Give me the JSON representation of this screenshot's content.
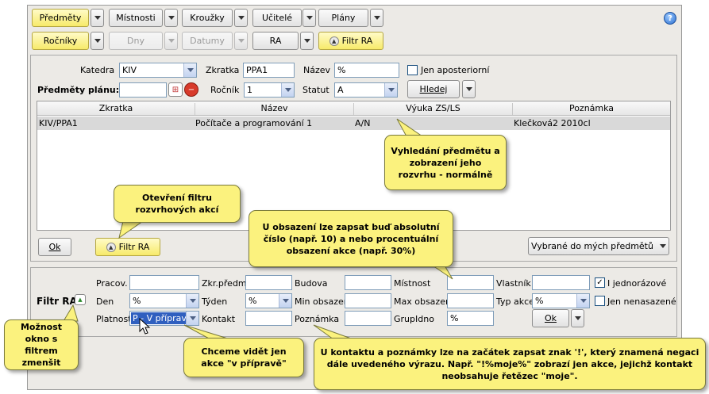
{
  "toolbar": {
    "row1": [
      "Předměty",
      "Místnosti",
      "Kroužky",
      "Učitelé",
      "Plány"
    ],
    "row2": [
      "Ročníky",
      "Dny",
      "Datumy",
      "RA",
      "Filtr RA"
    ]
  },
  "search": {
    "katedra_label": "Katedra",
    "katedra_value": "KIV",
    "zkratka_label": "Zkratka",
    "zkratka_value": "PPA1",
    "nazev_label": "Název",
    "nazev_value": "%",
    "jen_aposteriorni_label": "Jen aposteriorní",
    "predmety_planu_label": "Předměty plánu:",
    "rocnik_label": "Ročník",
    "rocnik_value": "1",
    "statut_label": "Statut",
    "statut_value": "A",
    "hledej_label": "Hledej"
  },
  "grid": {
    "columns": [
      "Zkratka",
      "Název",
      "Výuka ZS/LS",
      "Poznámka"
    ],
    "rows": [
      {
        "zkratka": "KIV/PPA1",
        "nazev": "Počítače a programování 1",
        "vyuka": "A/N",
        "poznamka": "Klečková2 2010cl"
      }
    ]
  },
  "grid_actions": {
    "ok_label": "Ok",
    "filtr_ra_label": "Filtr RA",
    "vybrane_label": "Vybrané do mých předmětů"
  },
  "filter": {
    "title": "Filtr RA",
    "pracov_label": "Pracov.",
    "den_label": "Den",
    "den_value": "%",
    "platnost_label": "Platnost",
    "platnost_value": "P - V přípravě",
    "zkr_predm_label": "Zkr.předm.",
    "tyden_label": "Týden",
    "tyden_value": "%",
    "kontakt_label": "Kontakt",
    "budova_label": "Budova",
    "min_obsazeni_label": "Min obsazení",
    "poznamka_label": "Poznámka",
    "mistnost_label": "Místnost",
    "max_obsazeni_label": "Max obsazení",
    "grupidno_label": "GrupIdno",
    "grupidno_value": "%",
    "vlastnik_label": "Vlastník",
    "typ_akce_label": "Typ akce",
    "typ_akce_value": "%",
    "i_jednorazove_label": "I jednorázové",
    "jen_nenasazene_label": "Jen nenasazené",
    "ok_label": "Ok"
  },
  "callouts": {
    "vyhledani": "Vyhledání předmětu a zobrazení jeho rozvrhu - normálně",
    "otevreni": "Otevření filtru rozvrhových akcí",
    "obsazeni": "U obsazení lze zapsat buď absolutní číslo (např. 10) a nebo procentuální obsazení akce (např. 30%)",
    "moznost": "Možnost okno s filtrem zmenšit",
    "chceme": "Chceme vidět jen akce \"v přípravě\"",
    "kontakt": "U kontaktu a poznámky lze na začátek zapsat znak '!', který znamená negaci dále uvedeného výrazu. Např. \"!%moje%\" zobrazí jen akce, jejichž kontakt neobsahuje řetězec \"moje\"."
  }
}
